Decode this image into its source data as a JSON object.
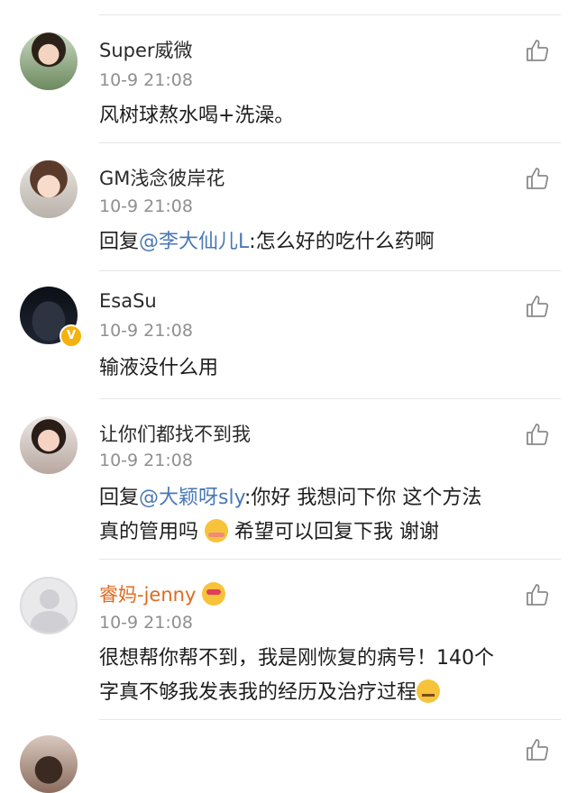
{
  "comments": [
    {
      "name": "Super威微",
      "time": "10-9 21:08",
      "text": "风树球熬水喝+洗澡。"
    },
    {
      "name": "GM浅念彼岸花",
      "time": "10-9 21:08",
      "reply_prefix": "回复",
      "mention": "@李大仙儿L",
      "text": ":怎么好的吃什么药啊"
    },
    {
      "name": "EsaSu",
      "time": "10-9 21:08",
      "verified_badge": "V",
      "text": "输液没什么用"
    },
    {
      "name": "让你们都找不到我",
      "time": "10-9 21:08",
      "reply_prefix": "回复",
      "mention": "@大颖呀sly",
      "text_line1": ":你好 我想问下你 这个方法",
      "text_line2_a": "真的管用吗 ",
      "text_line2_b": " 希望可以回复下我 谢谢",
      "emoji": "blush-emoji"
    },
    {
      "name": "睿妈-jenny",
      "name_color": "#e06a1f",
      "time": "10-9 21:08",
      "text_line1": "很想帮你帮不到，我是刚恢复的病号！140个",
      "text_line2": "字真不够我发表我的经历及治疗过程",
      "emoji_after_name": "love-emoji",
      "emoji_after_text": "sweat-emoji"
    }
  ],
  "colors": {
    "mention": "#4a78b5",
    "time": "#8f8f8f",
    "divider": "#e6e6e6",
    "badge": "#f5b10d"
  },
  "icons": {
    "like": "thumbs-up-icon",
    "default_avatar": "default-avatar-icon"
  }
}
